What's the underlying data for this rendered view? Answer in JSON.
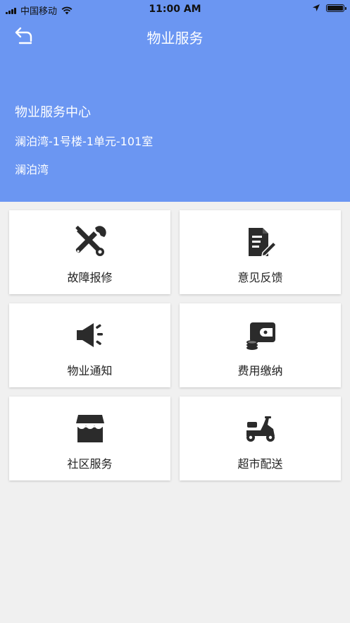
{
  "status_bar": {
    "carrier": "中国移动",
    "time": "11:00 AM"
  },
  "nav": {
    "title": "物业服务",
    "back_icon": "back-arrow-icon"
  },
  "info": {
    "center_name": "物业服务中心",
    "address": "澜泊湾-1号楼-1单元-101室",
    "community": "澜泊湾"
  },
  "colors": {
    "header_bg": "#6b96f2",
    "page_bg": "#f0f0f0",
    "icon": "#2b2b2b"
  },
  "services": [
    {
      "label": "故障报修",
      "icon": "repair-tools-icon"
    },
    {
      "label": "意见反馈",
      "icon": "feedback-document-icon"
    },
    {
      "label": "物业通知",
      "icon": "speaker-announcement-icon"
    },
    {
      "label": "费用缴纳",
      "icon": "wallet-payment-icon"
    },
    {
      "label": "社区服务",
      "icon": "storefront-icon"
    },
    {
      "label": "超市配送",
      "icon": "scooter-delivery-icon"
    }
  ]
}
